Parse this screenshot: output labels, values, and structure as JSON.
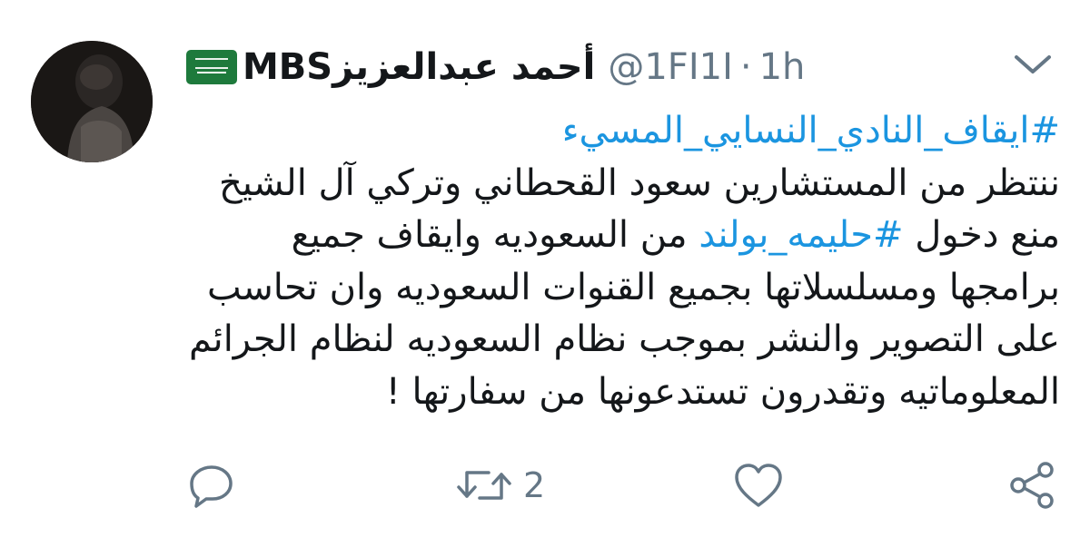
{
  "tweet": {
    "display_name": "أحمد عبدالعزيزMBS",
    "handle": "@1FI1I",
    "separator": "·",
    "time": "1h",
    "text_lines": [
      {
        "hashtag": "#ايقاف_النادي_النسايي_المسيء"
      },
      {
        "text": "ننتظر من المستشارين سعود القحطاني وتركي آل الشيخ"
      },
      {
        "before": "منع دخول ",
        "hashtag": "#حليمه_بولند",
        "after": " من السعوديه وايقاف جميع"
      },
      {
        "text": "برامجها ومسلسلاتها بجميع القنوات السعوديه وان تحاسب"
      },
      {
        "text": "على التصوير والنشر بموجب نظام السعوديه لنظام الجرائم"
      },
      {
        "text": "المعلوماتيه وتقدرون تستدعونها من سفارتها !"
      }
    ]
  },
  "actions": {
    "reply_icon": "reply-icon",
    "retweet_icon": "retweet-icon",
    "retweet_count": "2",
    "like_icon": "heart-icon",
    "share_icon": "share-icon"
  },
  "colors": {
    "hashtag": "#1b95e0",
    "muted": "#657786",
    "text": "#14171a",
    "flag": "#1e7a3c"
  }
}
